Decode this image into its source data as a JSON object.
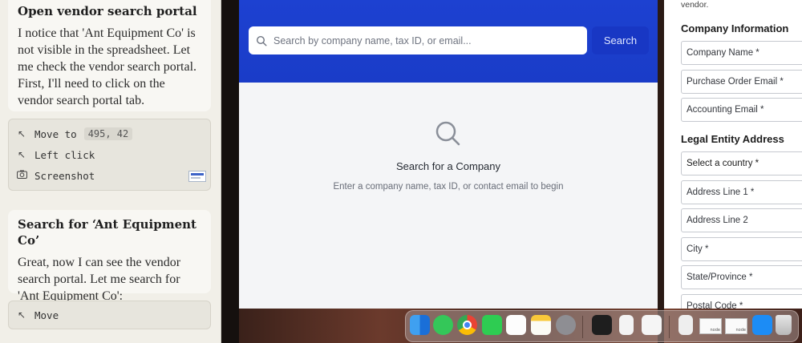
{
  "agent_panel": {
    "message1": {
      "title": "Open vendor search portal",
      "body": "I notice that 'Ant Equipment Co' is not visible in the spreadsheet. Let me check the vendor search portal. First, I'll need to click on the vendor search portal tab."
    },
    "actions1": [
      {
        "icon": "cursor-move-icon",
        "label": "Move to",
        "value": "495, 42"
      },
      {
        "icon": "cursor-click-icon",
        "label": "Left click"
      },
      {
        "icon": "camera-icon",
        "label": "Screenshot"
      }
    ],
    "message2": {
      "title": "Search for ‘Ant Equipment Co’",
      "body": "Great, now I can see the vendor search portal. Let me search for 'Ant Equipment Co':"
    },
    "actions2": [
      {
        "icon": "cursor-move-icon",
        "label": "Move"
      }
    ]
  },
  "vendor_portal": {
    "search_placeholder": "Search by company name, tax ID, or email...",
    "search_button": "Search",
    "empty_title": "Search for a Company",
    "empty_subtitle": "Enter a company name, tax ID, or contact email to begin",
    "header_color": "#1d41d1"
  },
  "vendor_form": {
    "top_text": "vendor.",
    "company_section": "Company Information",
    "company_fields": [
      "Company Name *",
      "Purchase Order Email *",
      "Accounting Email *"
    ],
    "address_section": "Legal Entity Address",
    "country_select": "Select a country *",
    "address_fields": [
      "Address Line 1 *",
      "Address Line 2",
      "City *",
      "State/Province *",
      "Postal Code *"
    ]
  },
  "dock": {
    "apps": [
      "finder-icon",
      "messages-icon",
      "chrome-icon",
      "facetime-icon",
      "reminders-icon",
      "notes-icon",
      "system-settings-icon",
      "terminal-icon",
      "document-icon",
      "textedit-icon",
      "file-icon",
      "app-store-icon",
      "trash-icon"
    ],
    "window_thumbs": [
      "node",
      "node"
    ]
  }
}
